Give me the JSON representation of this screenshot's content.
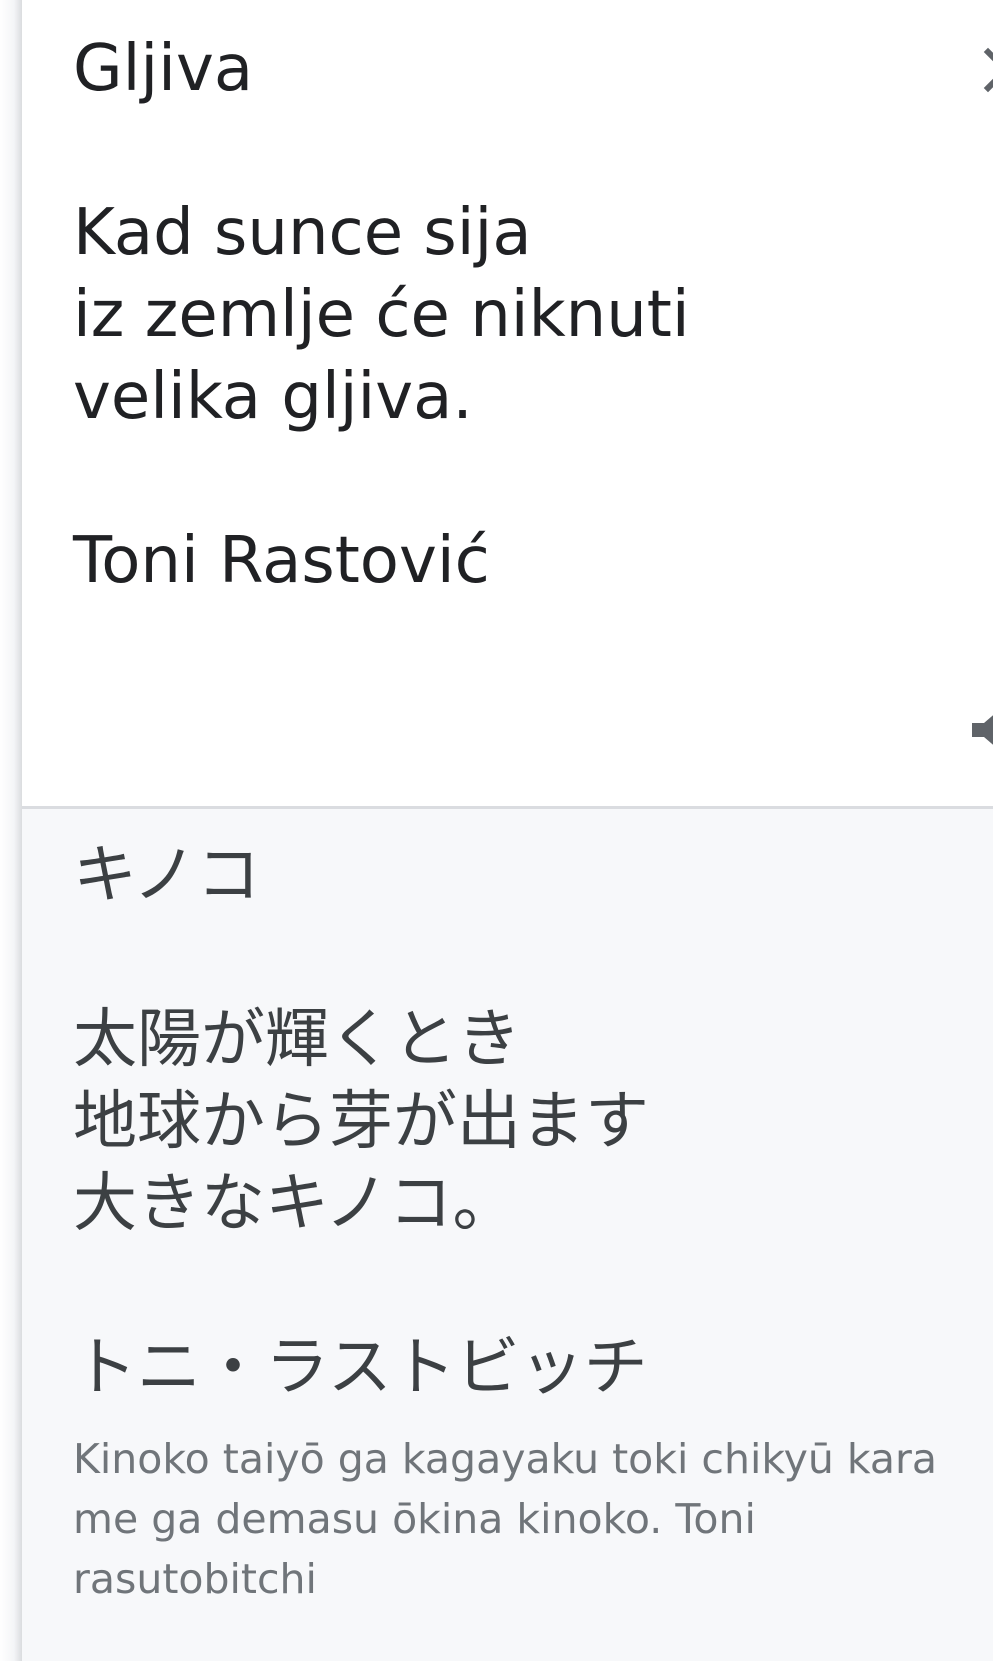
{
  "source": {
    "title": "Gljiva",
    "text": "Gljiva\n\nKad sunce sija\niz zemlje će niknuti\nvelika gljiva.\n\nToni Rastović"
  },
  "translation": {
    "text": "キノコ\n\n太陽が輝くとき\n地球から芽が出ます\n大きなキノコ。\n\nトニ・ラストビッチ",
    "romanization": "Kinoko taiyō ga kagayaku toki chikyū kara me ga demasu ōkina kinoko. Toni rasutobitchi"
  },
  "icons": {
    "close": "close-icon",
    "speaker": "speaker-icon"
  },
  "colors": {
    "source_text": "#202124",
    "translation_text": "#3c4043",
    "romanization_text": "#70757a",
    "translation_background": "#f7f8fa",
    "divider": "#dadce0",
    "icon": "#5f6368"
  }
}
